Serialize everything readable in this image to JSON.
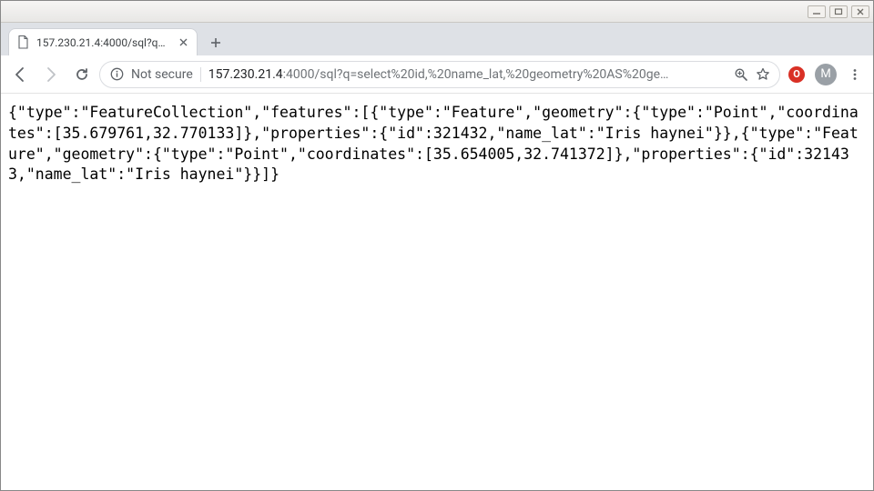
{
  "window": {
    "tab_title": "157.230.21.4:4000/sql?q=s"
  },
  "toolbar": {
    "not_secure_label": "Not secure",
    "url_host": "157.230.21.4",
    "url_path": ":4000/sql?q=select%20id,%20name_lat,%20geometry%20AS%20ge…"
  },
  "extensions": {
    "red_badge_letter": "O"
  },
  "profile": {
    "avatar_letter": "M"
  },
  "page_text": "{\"type\":\"FeatureCollection\",\"features\":[{\"type\":\"Feature\",\"geometry\":{\"type\":\"Point\",\"coordinates\":[35.679761,32.770133]},\"properties\":{\"id\":321432,\"name_lat\":\"Iris haynei\"}},{\"type\":\"Feature\",\"geometry\":{\"type\":\"Point\",\"coordinates\":[35.654005,32.741372]},\"properties\":{\"id\":321433,\"name_lat\":\"Iris haynei\"}}]}"
}
